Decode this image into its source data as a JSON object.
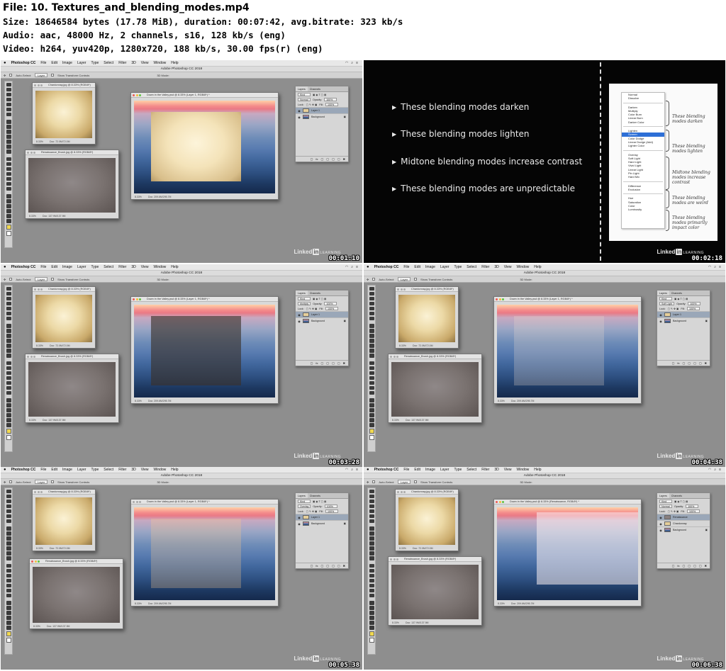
{
  "header": {
    "file_line": "File: 10. Textures_and_blending_modes.mp4",
    "size_line": "Size: 18646584 bytes (17.78 MiB), duration: 00:07:42, avg.bitrate: 323 kb/s",
    "audio_line": "Audio: aac, 48000 Hz, 2 channels, s16, 128 kb/s (eng)",
    "video_line": "Video: h264, yuv420p, 1280x720, 188 kb/s, 30.00 fps(r) (eng)"
  },
  "app": {
    "menubar": [
      "Photoshop CC",
      "File",
      "Edit",
      "Image",
      "Layer",
      "Type",
      "Select",
      "Filter",
      "3D",
      "View",
      "Window",
      "Help"
    ],
    "window_title": "Adobe Photoshop CC 2018",
    "options": {
      "auto_select": "Auto-Select:",
      "layer_select": "Layer",
      "show_transform": "Show Transform Controls",
      "three_d_mode": "3D Mode:"
    },
    "windows": {
      "chardonnay": "Chardonnay.jpg @ 8.33% (RGB/8*)",
      "renaissance": "Renaissance_Brush.jpg @ 8.33% (RGB/8*)",
      "valley_layer1": "Down in the Valley.psd @ 8.33% (Layer 1, RGB/8*) *",
      "valley_ren": "Down in the Valley.psd @ 8.33% (Renaissance, RGB/8*) *"
    },
    "status": {
      "zoom": "8.33%",
      "doc_chard": "Doc: 72.0M/72.0M",
      "doc_ren": "Doc: 137.9M/137.9M",
      "doc_valley": "Doc: 209.6M/295.7M"
    },
    "layers_panel": {
      "tab_layers": "Layers",
      "tab_channels": "Channels",
      "kind": "Kind",
      "lock": "Lock:",
      "opacity": "Opacity:",
      "opacity_val": "100%",
      "fill": "Fill:",
      "fill_val": "100%",
      "layer_names": [
        "Layer 1",
        "Background",
        "Renaissance",
        "Chardonnay"
      ],
      "modes": [
        "Normal",
        "Multiply",
        "Soft Light",
        "Screen",
        "Overlay"
      ]
    }
  },
  "timestamps": [
    "00:01:10",
    "00:02:18",
    "00:03:28",
    "00:04:38",
    "00:05:38",
    "00:06:38"
  ],
  "watermark": {
    "brand": "Linked",
    "in": "in",
    "learning": "LEARNING"
  },
  "slide": {
    "bullets": [
      "These blending modes darken",
      "These blending modes lighten",
      "Midtone blending modes increase contrast",
      "These blending modes are unpredictable"
    ],
    "menu_groups": [
      [
        "Normal",
        "Dissolve"
      ],
      [
        "Darken",
        "Multiply",
        "Color Burn",
        "Linear Burn",
        "Darker Color"
      ],
      [
        "Lighten",
        "Screen",
        "Color Dodge",
        "Linear Dodge (Add)",
        "Lighter Color"
      ],
      [
        "Overlay",
        "Soft Light",
        "Hard Light",
        "Vivid Light",
        "Linear Light",
        "Pin Light",
        "Hard Mix"
      ],
      [
        "Difference",
        "Exclusion"
      ],
      [
        "Hue",
        "Saturation",
        "Color",
        "Luminosity"
      ]
    ],
    "selected_item": "Screen",
    "notes": [
      [
        "These blending",
        "modes darken"
      ],
      [
        "These blending",
        "modes lighten"
      ],
      [
        "Midtone blending",
        "modes increase",
        "contrast"
      ],
      [
        "These blending",
        "modes are weird"
      ],
      [
        "These blending",
        "modes primarily",
        "impact color"
      ]
    ]
  }
}
